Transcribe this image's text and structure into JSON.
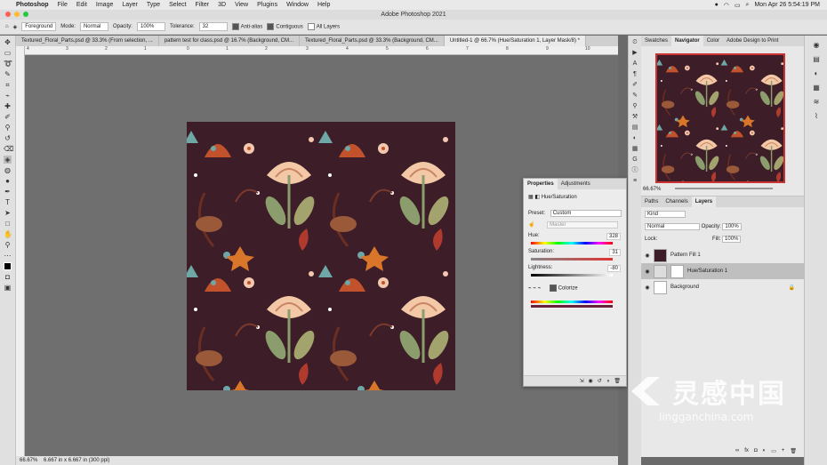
{
  "menubar": {
    "app": "Photoshop",
    "items": [
      "File",
      "Edit",
      "Image",
      "Layer",
      "Type",
      "Select",
      "Filter",
      "3D",
      "View",
      "Plugins",
      "Window",
      "Help"
    ],
    "clock": "Mon Apr 26  5:54:19 PM"
  },
  "window": {
    "title": "Adobe Photoshop 2021"
  },
  "options": {
    "foreground": "Foreground",
    "mode_label": "Mode:",
    "mode_value": "Normal",
    "opacity_label": "Opacity:",
    "opacity_value": "100%",
    "tolerance_label": "Tolerance:",
    "tolerance_value": "32",
    "antialias": "Anti-alias",
    "contiguous": "Contiguous",
    "all_layers": "All Layers"
  },
  "doc_tabs": [
    "Textured_Floral_Parts.psd @ 33.3% (From selection, ...",
    "pattern test for class.psd @ 16.7% (Background, CM...",
    "Textured_Floral_Parts.psd @ 33.3% (Background, CM...",
    "Untitled-1 @ 66.7% (Hue/Saturation 1, Layer Mask/8) *"
  ],
  "status": {
    "zoom": "66.67%",
    "doc": "6.667 in x 6.667 in (300 ppi)"
  },
  "rulers": [
    "4",
    "3",
    "2",
    "1",
    "0",
    "1",
    "2",
    "3",
    "4",
    "5",
    "6",
    "7",
    "8",
    "9",
    "10"
  ],
  "properties": {
    "tabs": [
      "Properties",
      "Adjustments"
    ],
    "title": "Hue/Saturation",
    "preset_label": "Preset:",
    "preset_value": "Custom",
    "channel": "Master",
    "hue_label": "Hue:",
    "hue_value": "328",
    "sat_label": "Saturation:",
    "sat_value": "31",
    "light_label": "Lightness:",
    "light_value": "-80",
    "colorize": "Colorize"
  },
  "navigator": {
    "tabs": [
      "Swatches",
      "Navigator",
      "Color",
      "Adobe Design to Print"
    ],
    "zoom": "66.67%"
  },
  "layers": {
    "tabs": [
      "Paths",
      "Channels",
      "Layers"
    ],
    "kind": "Kind",
    "blend": "Normal",
    "opacity_label": "Opacity:",
    "opacity_value": "100%",
    "lock_label": "Lock:",
    "fill_label": "Fill:",
    "fill_value": "100%",
    "items": [
      "Pattern Fill 1",
      "Hue/Saturation 1",
      "Background"
    ]
  },
  "watermark": {
    "big": "灵感中国",
    "small": "lingganchina.com"
  }
}
